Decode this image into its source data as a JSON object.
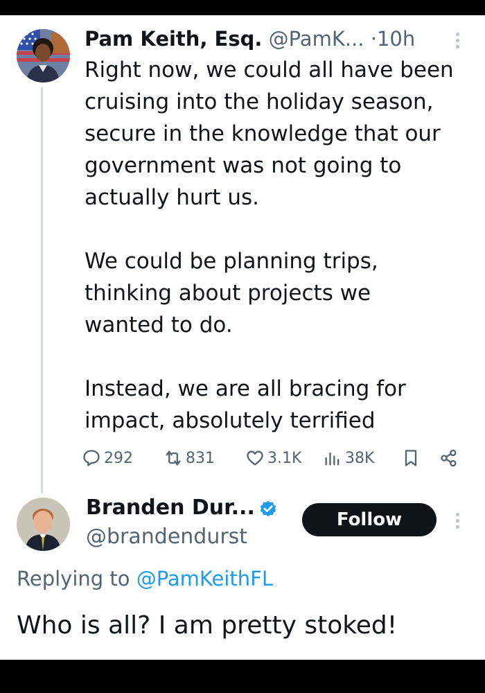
{
  "tweet1": {
    "name": "Pam Keith, Esq.",
    "handle": "@PamK...",
    "separator": "·",
    "time": "10h",
    "paragraphs": [
      [
        "Right now, we could all have been",
        "cruising into the holiday season,",
        "secure in the knowledge that our",
        "government was not going to",
        "actually hurt us."
      ],
      [
        "We could be planning trips,",
        "thinking about projects we",
        "wanted to do."
      ],
      [
        "Instead, we are all bracing for",
        "impact, absolutely terrified"
      ]
    ],
    "stats": {
      "replies": "292",
      "reposts": "831",
      "likes": "3.1K",
      "views": "38K"
    },
    "icons": [
      "reply-icon",
      "repost-icon",
      "like-icon",
      "views-icon",
      "bookmark-icon",
      "share-icon",
      "more-icon"
    ]
  },
  "tweet2": {
    "name": "Branden Dur...",
    "handle": "@brandendurst",
    "follow_label": "Follow",
    "replying_prefix": "Replying to ",
    "replying_to": "@PamKeithFL",
    "text": "Who is all? I am pretty stoked!",
    "icons": [
      "verified-badge-icon",
      "more-icon"
    ]
  },
  "colors": {
    "text": "#0f1419",
    "secondary": "#536471",
    "accent": "#1d9bf0",
    "follow_bg": "#0f1419"
  }
}
